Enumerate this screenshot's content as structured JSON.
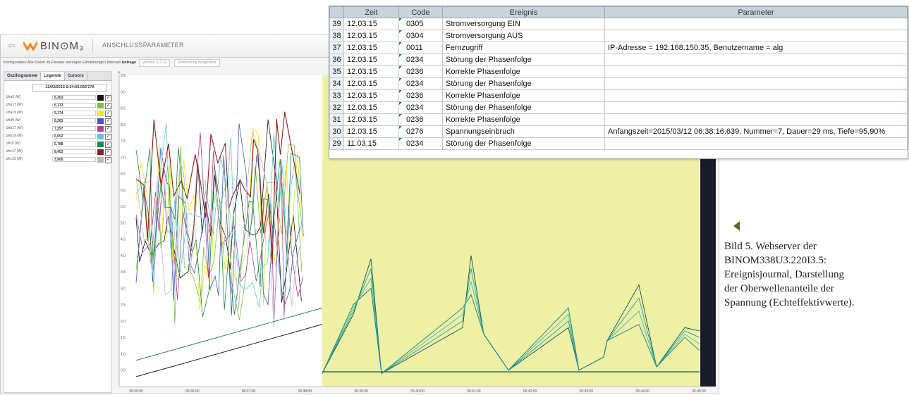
{
  "header": {
    "back_icon": "back-arrow-icon",
    "logo_text": "BIN⊙M₃",
    "page_title": "ANSCHLUSSPARAMETER"
  },
  "config_bar": {
    "text": "Konfiguration  Alle Daten im Fenster anzeigen  Einstellungen  Intervall",
    "anfrage": "Anfrage",
    "version": "Version 3.2.11",
    "status": "Verbindung hergestellt"
  },
  "sidebar": {
    "tabs": [
      "Oszillogramme",
      "Legende",
      "Cursors"
    ],
    "active_tab": "Legende",
    "timestamp": "12/03/2015  6:34:55.055'276",
    "legend": [
      {
        "name": "Uha9 (W)",
        "value": "6,303",
        "color": "#111111",
        "checked": true
      },
      {
        "name": "Uha17 (W)",
        "value": "6,133",
        "color": "#7bc043",
        "checked": true
      },
      {
        "name": "Uha19 (W)",
        "value": "5,174",
        "color": "#f2e521",
        "checked": true
      },
      {
        "name": "Uhb9 (W)",
        "value": "6,262",
        "color": "#3b5bb5",
        "checked": true
      },
      {
        "name": "Uhb17 (W)",
        "value": "7,297",
        "color": "#b0418f",
        "checked": true
      },
      {
        "name": "Uhb19 (W)",
        "value": "6,052",
        "color": "#5cc6dd",
        "checked": true
      },
      {
        "name": "Uhc9 (W)",
        "value": "5,788",
        "color": "#1d8a4a",
        "checked": true
      },
      {
        "name": "Uhc17 (W)",
        "value": "8,453",
        "color": "#8e1d1d",
        "checked": true
      },
      {
        "name": "Uhc19 (W)",
        "value": "3,900",
        "color": "#b9b9b9",
        "checked": true
      }
    ]
  },
  "chart_data": {
    "type": "line",
    "y_axis_label": "V",
    "ylim": [
      0,
      9.5
    ],
    "y_ticks": [
      "0,5",
      "1,0",
      "1,5",
      "2,0",
      "2,5",
      "3,0",
      "3,5",
      "4,0",
      "4,5",
      "5,0",
      "5,5",
      "6,0",
      "6,5",
      "7,0",
      "7,5",
      "8,0",
      "8,5",
      "9,0",
      "9,5"
    ],
    "x_ticks": [
      "06:35:00",
      "06:36:00",
      "06:37:00",
      "06:38:00",
      "06:39:00",
      "06:40:00",
      "06:41:00",
      "06:42:00",
      "06:43:00",
      "06:44:00",
      "06:45:00"
    ],
    "grid": false,
    "highlight_region": {
      "from": "06:38:30",
      "to": "06:45:00",
      "color": "#eef0a6"
    }
  },
  "journal": {
    "headers": [
      "Zeit",
      "Code",
      "Ereignis",
      "Parameter"
    ],
    "rows": [
      {
        "n": "39",
        "zeit": "12.03.15",
        "code": "0305",
        "ereignis": "Stromversorgung EIN",
        "parameter": ""
      },
      {
        "n": "38",
        "zeit": "12.03.15",
        "code": "0304",
        "ereignis": "Stromversorgung AUS",
        "parameter": ""
      },
      {
        "n": "37",
        "zeit": "12.03.15",
        "code": "0011",
        "ereignis": "Fernzugriff",
        "parameter": "IP-Adresse = 192.168.150.35, Benutzername = alg"
      },
      {
        "n": "36",
        "zeit": "12.03.15",
        "code": "0234",
        "ereignis": "Störung der Phasenfolge",
        "parameter": ""
      },
      {
        "n": "35",
        "zeit": "12.03.15",
        "code": "0236",
        "ereignis": "Korrekte Phasenfolge",
        "parameter": ""
      },
      {
        "n": "34",
        "zeit": "12.03.15",
        "code": "0234",
        "ereignis": "Störung der Phasenfolge",
        "parameter": ""
      },
      {
        "n": "33",
        "zeit": "12.03.15",
        "code": "0236",
        "ereignis": "Korrekte Phasenfolge",
        "parameter": ""
      },
      {
        "n": "32",
        "zeit": "12.03.15",
        "code": "0234",
        "ereignis": "Störung der Phasenfolge",
        "parameter": ""
      },
      {
        "n": "31",
        "zeit": "12.03.15",
        "code": "0236",
        "ereignis": "Korrekte Phasenfolge",
        "parameter": ""
      },
      {
        "n": "30",
        "zeit": "12.03.15",
        "code": "0276",
        "ereignis": "Spannungseinbruch",
        "parameter": "Anfangszeit=2015/03/12 06:38:16.639, Nummer=7, Dauer=29 ms,  Tiefe=95,90%"
      },
      {
        "n": "29",
        "zeit": "11.03.15",
        "code": "0234",
        "ereignis": "Störung der Phasenfolge",
        "parameter": ""
      }
    ]
  },
  "caption": {
    "lines": [
      "Bild 5. Webserver der",
      "BINOM338U3.220I3.5:",
      "Ereignisjournal, Darstellung",
      "der Oberwellenanteile der",
      "Spannung (Echteffektivwerte)."
    ]
  }
}
